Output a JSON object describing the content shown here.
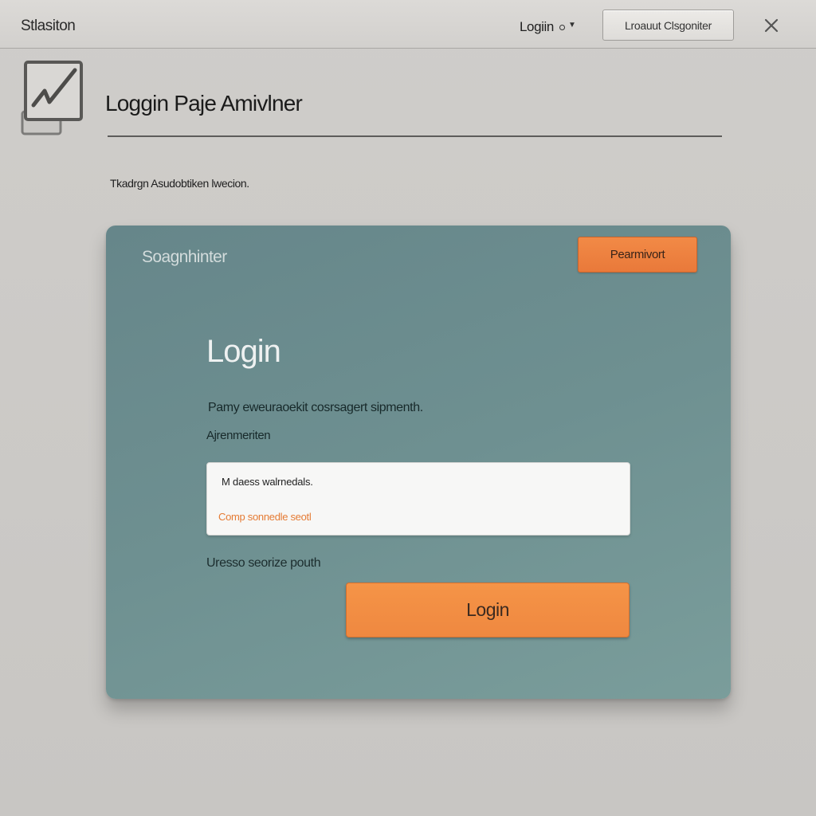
{
  "topbar": {
    "app_title": "Stlasiton",
    "login_menu_label": "Logiin",
    "button_label": "Lroauut Clsgoniter"
  },
  "header": {
    "page_title": "Loggin Paje Amivlner",
    "subtitle": "Tkadrgn Asudobtiken lwecion."
  },
  "card": {
    "brand": "Soagnhinter",
    "top_button_label": "Pearmivort",
    "heading": "Login",
    "description": "Pamy eweuraoekit cosrsagert sipmenth.",
    "field_label": "Ajrenmeriten",
    "field_value": "M daess walrnedals.",
    "field_hint": "Comp sonnedle seotl",
    "helper_text": "Uresso seorize pouth",
    "login_button_label": "Login"
  },
  "colors": {
    "accent": "#ef8840",
    "card": "#6e9091",
    "background": "#cbc9c6"
  },
  "icons": {
    "logo": "checkbox-check-icon",
    "close": "close-icon",
    "menu_indicator": "chevron-down-icon"
  }
}
